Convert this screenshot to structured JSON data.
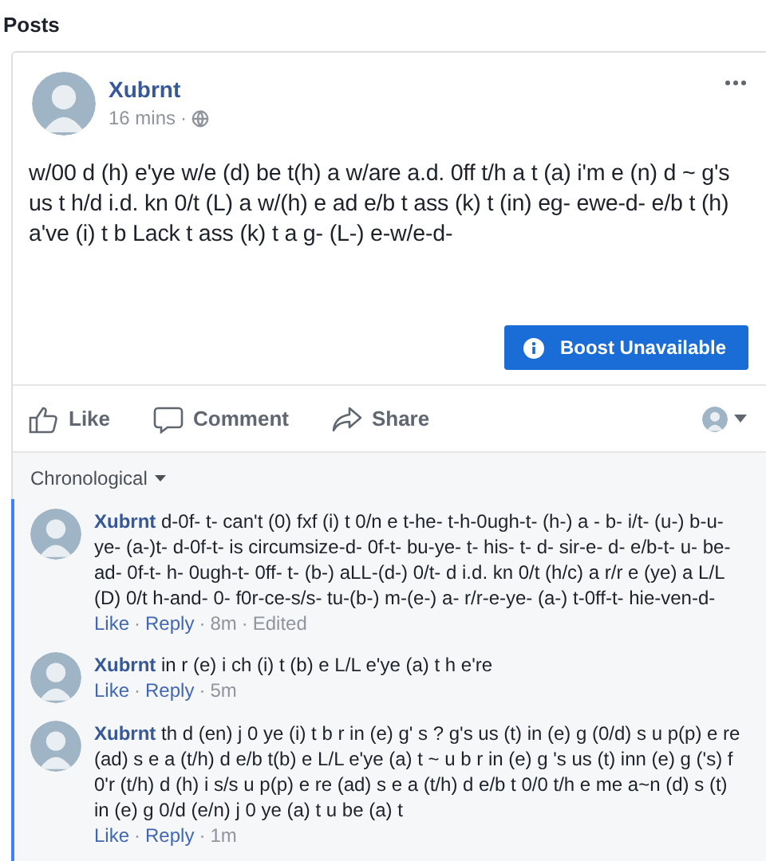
{
  "section_title": "Posts",
  "post": {
    "author": "Xubrnt",
    "time": "16 mins",
    "separator": "·",
    "text": "w/00 d (h) e'ye w/e (d) be t(h) a w/are a.d. 0ff t/h a t (a) i'm e (n) d ~ g's us t h/d i.d. kn 0/t (L) a w/(h) e ad e/b t ass (k) t (in) eg- ewe-d- e/b t (h) a've (i) t b Lack t ass (k) t a g- (L-) e-w/e-d-",
    "boost_button": "Boost Unavailable",
    "actions": [
      {
        "kind": "like",
        "label": "Like"
      },
      {
        "kind": "comment",
        "label": "Comment"
      },
      {
        "kind": "share",
        "label": "Share"
      }
    ]
  },
  "comments_sort": "Chronological",
  "comments": [
    {
      "author": "Xubrnt",
      "text": "d-0f- t- can't (0) fxf (i) t 0/n e t-he- t-h-0ugh-t- (h-) a - b- i/t- (u-) b-u-ye- (a-)t- d-0f-t- is circumsize-d- 0f-t- bu-ye- t- his- t- d- sir-e- d- e/b-t- u- be-ad- 0f-t- h- 0ugh-t- 0ff- t- (b-) aLL-(d-) 0/t- d i.d. kn 0/t (h/c) a r/r e (ye) a L/L (D) 0/t h-and- 0- f0r-ce-s/s- tu-(b-) m-(e-) a- r/r-e-ye- (a-) t-0ff-t- hie-ven-d-",
      "like": "Like",
      "reply": "Reply",
      "separator": "·",
      "time": "8m",
      "edited": "Edited"
    },
    {
      "author": "Xubrnt",
      "text": "in r (e) i ch (i) t (b) e L/L e'ye (a) t h e're",
      "like": "Like",
      "reply": "Reply",
      "separator": "·",
      "time": "5m"
    },
    {
      "author": "Xubrnt",
      "text": "th d (en) j 0 ye (i) t b r in (e) g' s ? g's us (t) in (e) g (0/d) s u p(p) e re (ad) s e a (t/h) d e/b t(b) e L/L e'ye (a) t ~ u b r in (e) g 's us (t) inn (e) g ('s) f 0'r (t/h) d (h) i s/s u p(p) e re (ad) s e a (t/h) d e/b t 0/0 t/h e me a~n (d) s (t) in (e) g 0/d (e/n) j 0 ye (a) t u be (a) t",
      "like": "Like",
      "reply": "Reply",
      "separator": "·",
      "time": "1m"
    }
  ]
}
